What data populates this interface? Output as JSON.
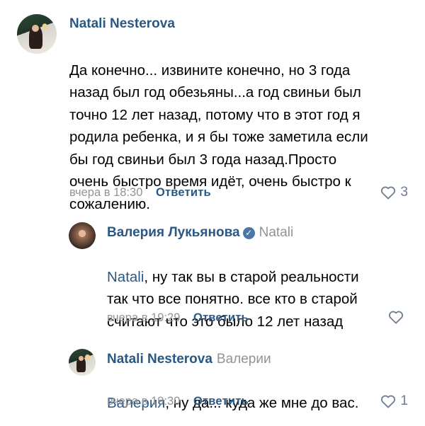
{
  "comments": [
    {
      "author": "Natali Nesterova",
      "reply_to": "",
      "mention": "",
      "text": "Да конечно... извините конечно, но 3 года\nназад был год обезьяны...а год свиньи был\nточно 12 лет назад, потому что в этот год я\nродила ребенка, и я бы тоже заметила если\nбы год свиньи был 3 года назад.Просто\nочень быстро время идёт, очень быстро к\nсожалению.",
      "time": "вчера в 18:30",
      "reply_label": "Ответить",
      "likes": "3",
      "avatar_icon": "avatar-photo-christmas-tree"
    },
    {
      "author": "Валерия Лукьянова",
      "verified_icon": "verified-checkmark-icon",
      "reply_to": "Natali",
      "mention": "Natali",
      "text": ", ну так вы в старой реальности\nтак что все понятно. все кто в старой\nсчитают что это было 12 лет назад",
      "time": "вчера в 19:29",
      "reply_label": "Ответить",
      "likes": "",
      "avatar_icon": "avatar-photo-portrait"
    },
    {
      "author": "Natali Nesterova",
      "reply_to": "Валерии",
      "mention": "Валерия",
      "text": ", ну да... куда же мне до вас.",
      "time": "вчера в 19:30",
      "reply_label": "Ответить",
      "likes": "1",
      "avatar_icon": "avatar-photo-christmas-tree"
    }
  ],
  "colors": {
    "link": "#2a5885",
    "meta": "#939393",
    "like_icon": "#6b7d91",
    "verified": "#4a76a8"
  }
}
